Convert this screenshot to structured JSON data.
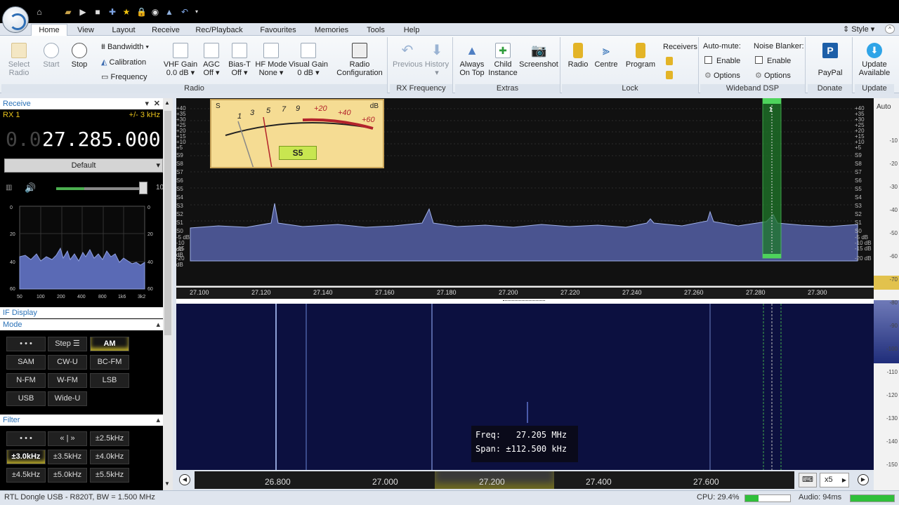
{
  "titlebar": {
    "style_label": "Style"
  },
  "tabs": [
    "Home",
    "View",
    "Layout",
    "Receive",
    "Rec/Playback",
    "Favourites",
    "Memories",
    "Tools",
    "Help"
  ],
  "ribbon": {
    "radio": {
      "title": "Radio",
      "select": "Select\nRadio",
      "start": "Start",
      "stop": "Stop",
      "bandwidth": "Bandwidth",
      "calibration": "Calibration",
      "frequency": "Frequency",
      "vhf_gain": "VHF Gain",
      "vhf_gain_val": "0.0 dB",
      "agc": "AGC",
      "agc_val": "Off",
      "biast": "Bias-T",
      "biast_val": "Off",
      "hfmode": "HF Mode",
      "hfmode_val": "None",
      "visual_gain": "Visual Gain",
      "visual_gain_val": "0 dB",
      "radio_config": "Radio\nConfiguration"
    },
    "rxfreq": {
      "title": "RX Frequency",
      "previous": "Previous",
      "history": "History"
    },
    "extras": {
      "title": "Extras",
      "always_on_top": "Always\nOn Top",
      "child_instance": "Child\nInstance",
      "screenshot": "Screenshot"
    },
    "lock": {
      "title": "Lock",
      "radio": "Radio",
      "centre": "Centre",
      "program": "Program",
      "receivers": "Receivers"
    },
    "dsp": {
      "title": "Wideband DSP",
      "automute": "Auto-mute:",
      "noise_blanker": "Noise Blanker:",
      "enable": "Enable",
      "options": "Options"
    },
    "donate": {
      "title": "Donate",
      "paypal": "PayPal"
    },
    "update": {
      "title": "Update",
      "label": "Update\nAvailable"
    }
  },
  "receive_panel": {
    "title": "Receive",
    "rx": "RX 1",
    "bw": "+/- 3 kHz",
    "freq_dim": "0.0",
    "freq": "27.285.000",
    "profile": "Default",
    "vol_max": "10"
  },
  "if_display": {
    "title": "IF Display",
    "x_ticks": [
      "50",
      "100",
      "200",
      "400",
      "800",
      "1k6",
      "3k2"
    ],
    "y_ticks": [
      "0",
      "20",
      "40",
      "60"
    ]
  },
  "mode_panel": {
    "title": "Mode",
    "buttons": [
      "• • •",
      "Step ☰",
      "AM",
      "SAM",
      "CW-U",
      "BC-FM",
      "N-FM",
      "W-FM",
      "LSB",
      "USB",
      "Wide-U"
    ],
    "selected": "AM"
  },
  "filter_panel": {
    "title": "Filter",
    "buttons": [
      "• • •",
      "« | »",
      "±2.5kHz",
      "±3.0kHz",
      "±3.5kHz",
      "±4.0kHz",
      "±4.5kHz",
      "±5.0kHz",
      "±5.5kHz"
    ],
    "selected": "±3.0kHz"
  },
  "smeter": {
    "s": "S",
    "db": "dB",
    "reading": "S5",
    "scale": [
      "1",
      "3",
      "5",
      "7",
      "9",
      "+20",
      "+40",
      "+60"
    ]
  },
  "spectrum": {
    "left_scale": [
      "+40",
      "+35",
      "+30",
      "+25",
      "+20",
      "+15",
      "+10",
      "+5",
      "S9",
      "S8",
      "S7",
      "S6",
      "S5",
      "S4",
      "S3",
      "S2",
      "S1",
      "S0",
      "-5 dB",
      "-10 dB",
      "-15 dB",
      "-20 dB"
    ],
    "right_scale": [
      "+40",
      "+35",
      "+30",
      "+25",
      "+20",
      "+15",
      "+10",
      "+5",
      "S9",
      "S8",
      "S7",
      "S6",
      "S5",
      "S4",
      "S3",
      "S2",
      "S1",
      "S0",
      "-5 dB",
      "-10 dB",
      "-15 dB",
      "-20 dB"
    ],
    "freq_ticks": [
      "27.100",
      "27.120",
      "27.140",
      "27.160",
      "27.180",
      "27.200",
      "27.220",
      "27.240",
      "27.260",
      "27.280",
      "27.300"
    ],
    "receiver_marker": "1",
    "auto": "Auto"
  },
  "right_scale": [
    "-10",
    "-20",
    "-30",
    "-40",
    "-50",
    "-60",
    "-70",
    "-80",
    "-90",
    "-100",
    "-110",
    "-120",
    "-130",
    "-140",
    "-150"
  ],
  "waterfall": {
    "freq_label": "Freq:",
    "freq_value": "27.205 MHz",
    "span_label": "Span:",
    "span_value": "±112.500 kHz"
  },
  "overview": {
    "ticks": [
      "26.800",
      "27.000",
      "27.200",
      "27.400",
      "27.600"
    ],
    "zoom": "x5"
  },
  "status": {
    "device": "RTL Dongle USB - R820T, BW = 1.500 MHz",
    "cpu": "CPU: 29.4%",
    "cpu_level": 0.294,
    "audio": "Audio: 94ms"
  }
}
